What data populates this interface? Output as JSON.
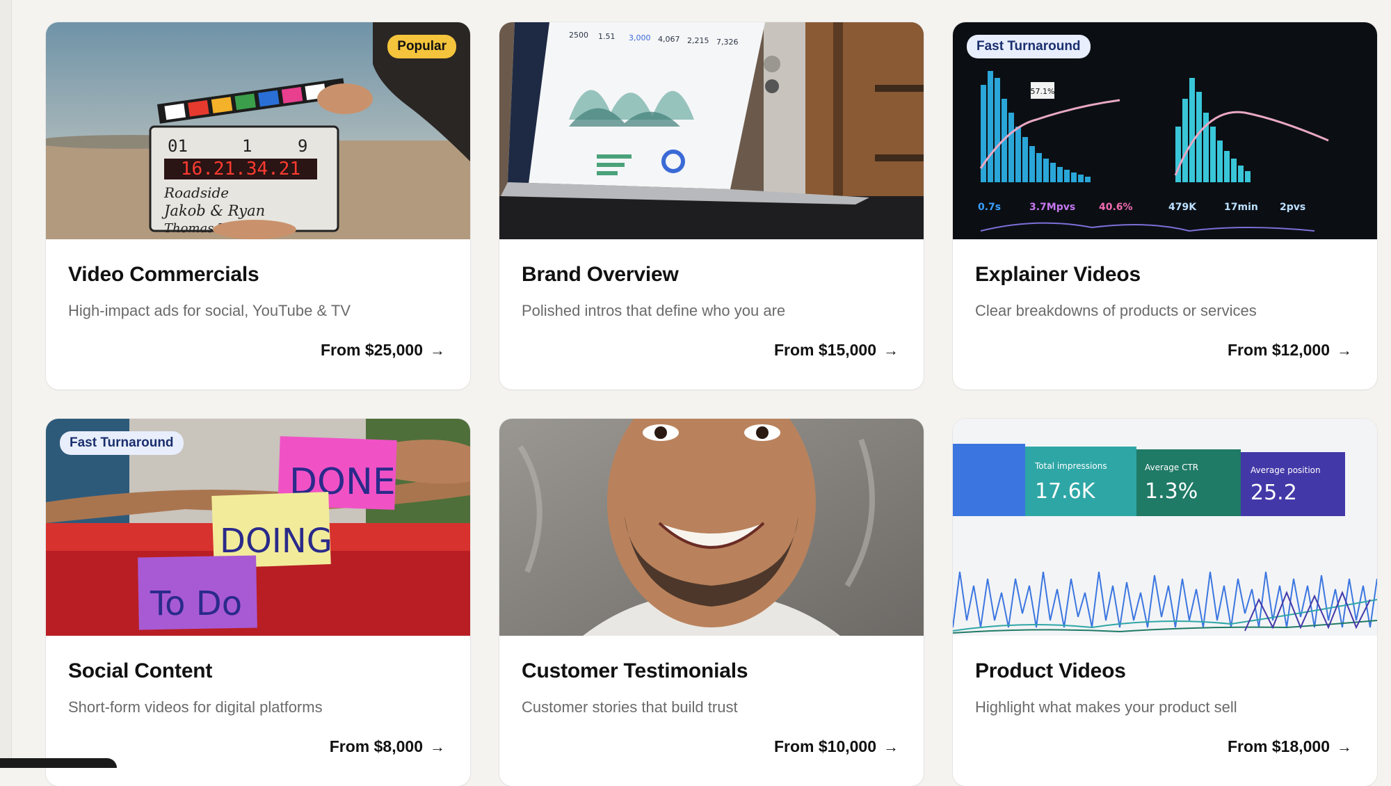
{
  "cards": [
    {
      "title": "Video Commercials",
      "description": "High-impact ads for social, YouTube & TV",
      "price": "From $25,000",
      "badge": "Popular",
      "arrow": "→",
      "clapper": {
        "roll": "01",
        "scene": "1",
        "take": "9",
        "timecode": "16.21.34.21",
        "line1": "Roadside",
        "line2": "Jakob & Ryan",
        "line3": "Thomas Taugher"
      }
    },
    {
      "title": "Brand Overview",
      "description": "Polished intros that define who you are",
      "price": "From $15,000",
      "arrow": "→",
      "screen_stats": [
        "2500",
        "1.51",
        "3,000",
        "4,067",
        "2,215",
        "7,326"
      ]
    },
    {
      "title": "Explainer Videos",
      "description": "Clear breakdowns of products or services",
      "price": "From $12,000",
      "badge": "Fast Turnaround",
      "arrow": "→",
      "dash_stats": [
        "57.1%",
        "0.7s",
        "3.7Mpvs",
        "40.6%",
        "479K",
        "17min",
        "2pvs"
      ]
    },
    {
      "title": "Social Content",
      "description": "Short-form videos for digital platforms",
      "price": "From $8,000",
      "badge": "Fast Turnaround",
      "arrow": "→",
      "notes": [
        "DONE",
        "DOING",
        "To Do"
      ]
    },
    {
      "title": "Customer Testimonials",
      "description": "Customer stories that build trust",
      "price": "From $10,000",
      "arrow": "→"
    },
    {
      "title": "Product Videos",
      "description": "Highlight what makes your product sell",
      "price": "From $18,000",
      "arrow": "→",
      "metrics": [
        {
          "label": "Total impressions",
          "value": "17.6K"
        },
        {
          "label": "Average CTR",
          "value": "1.3%"
        },
        {
          "label": "Average position",
          "value": "25.2"
        }
      ]
    }
  ]
}
